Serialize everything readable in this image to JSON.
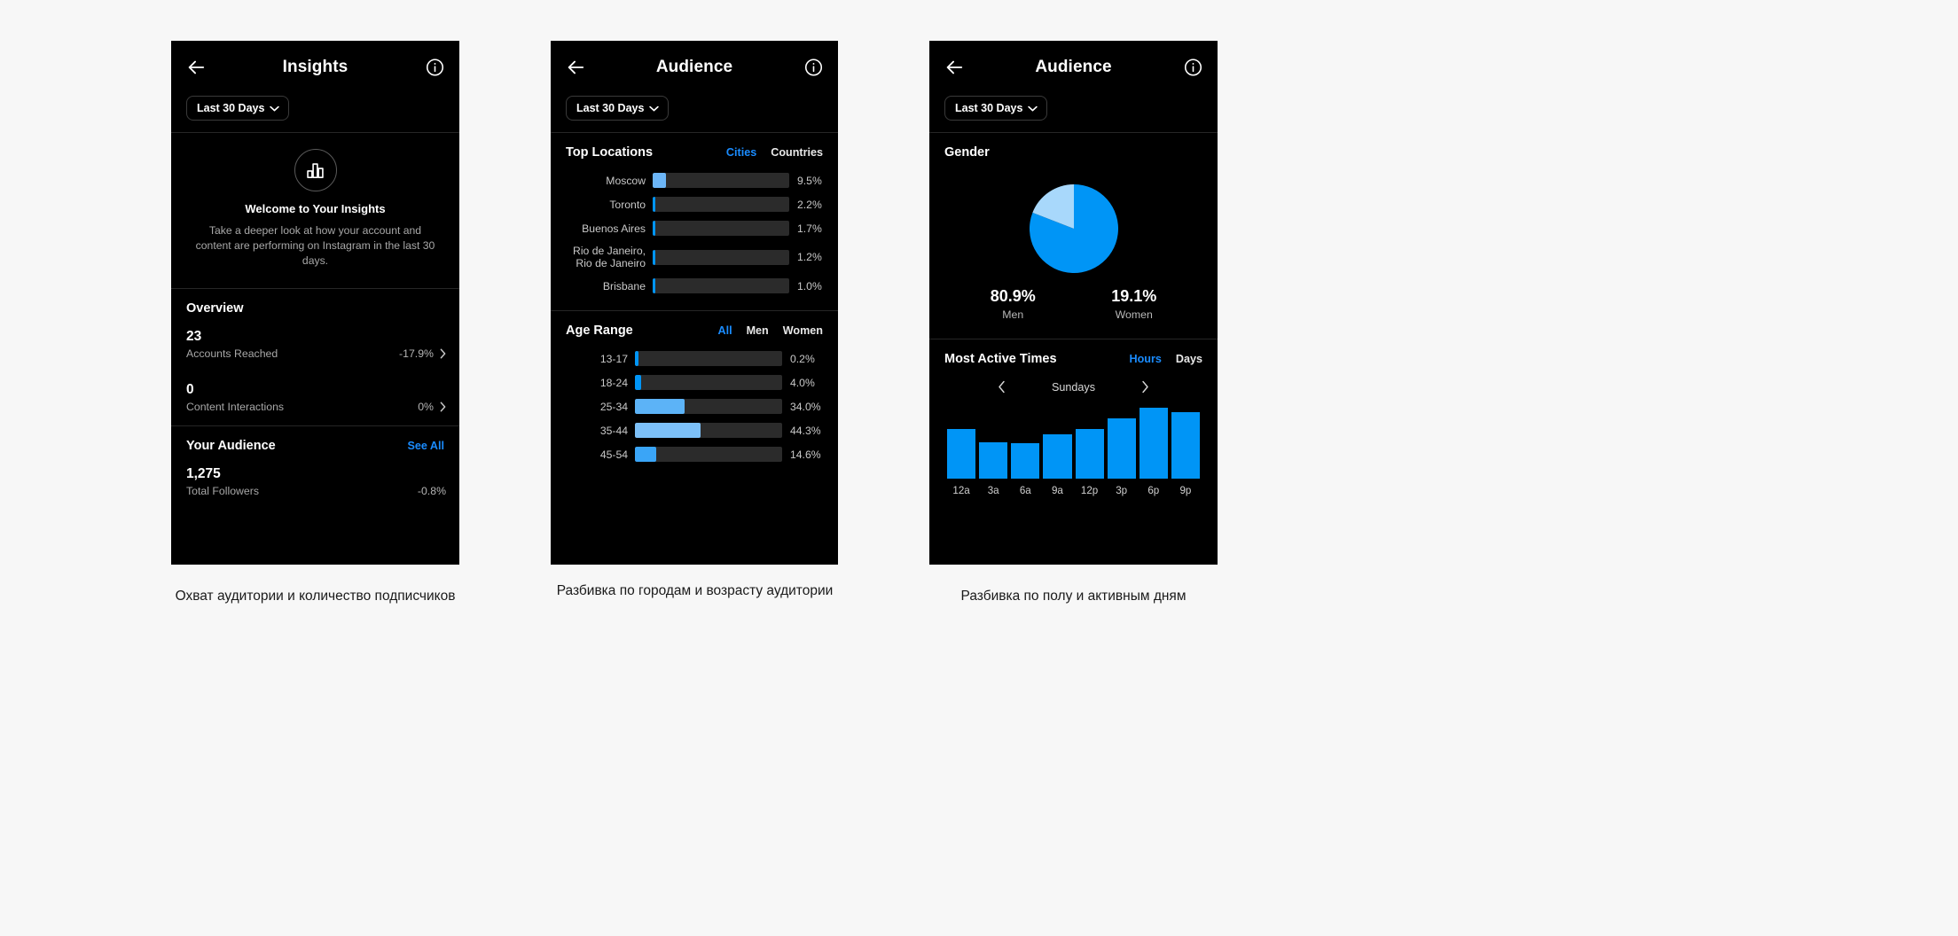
{
  "colors": {
    "accent": "#1a8cff",
    "bar_blue": "#0095f6",
    "bar_blue_light": "#6cb6f7",
    "track": "#2b2b2b",
    "phone_bg": "#000000",
    "page_bg": "#f7f7f7"
  },
  "phone1": {
    "header": {
      "title": "Insights",
      "back_icon": "arrow-left-icon",
      "info_icon": "info-circle-icon"
    },
    "range": {
      "label": "Last 30 Days",
      "chevron": "chevron-down-icon"
    },
    "welcome": {
      "icon": "bar-chart-icon",
      "title": "Welcome to Your Insights",
      "body": "Take a deeper look at how your account and content are performing on Instagram in the last 30 days."
    },
    "overview": {
      "title": "Overview",
      "rows": [
        {
          "value": "23",
          "label": "Accounts Reached",
          "delta": "-17.9%",
          "chevron": "chevron-right-icon"
        },
        {
          "value": "0",
          "label": "Content Interactions",
          "delta": "0%",
          "chevron": "chevron-right-icon"
        }
      ]
    },
    "audience": {
      "title": "Your Audience",
      "see_all": "See All",
      "rows": [
        {
          "value": "1,275",
          "label": "Total Followers",
          "delta": "-0.8%"
        }
      ]
    }
  },
  "phone2": {
    "header": {
      "title": "Audience",
      "back_icon": "arrow-left-icon",
      "info_icon": "info-circle-icon"
    },
    "range": {
      "label": "Last 30 Days",
      "chevron": "chevron-down-icon"
    },
    "top_locations": {
      "title": "Top Locations",
      "tabs": [
        {
          "label": "Cities",
          "active": true
        },
        {
          "label": "Countries",
          "active": false
        }
      ]
    },
    "age_range": {
      "title": "Age Range",
      "tabs": [
        {
          "label": "All",
          "active": true
        },
        {
          "label": "Men",
          "active": false
        },
        {
          "label": "Women",
          "active": false
        }
      ]
    }
  },
  "phone3": {
    "header": {
      "title": "Audience",
      "back_icon": "arrow-left-icon",
      "info_icon": "info-circle-icon"
    },
    "range": {
      "label": "Last 30 Days",
      "chevron": "chevron-down-icon"
    },
    "gender": {
      "title": "Gender",
      "legend": [
        {
          "value": "80.9%",
          "label": "Men"
        },
        {
          "value": "19.1%",
          "label": "Women"
        }
      ]
    },
    "active_times": {
      "title": "Most Active Times",
      "tabs": [
        {
          "label": "Hours",
          "active": true
        },
        {
          "label": "Days",
          "active": false
        }
      ],
      "day_label": "Sundays",
      "prev_icon": "chevron-left-icon",
      "next_icon": "chevron-right-icon"
    }
  },
  "captions": {
    "one": "Охват аудитории и количество подписчиков",
    "two": "Разбивка по городам и возрасту аудитории",
    "three": "Разбивка по полу и активным дням"
  },
  "chart_data": [
    {
      "type": "bar",
      "title": "Top Locations",
      "orientation": "horizontal",
      "categories": [
        "Moscow",
        "Toronto",
        "Buenos Aires",
        "Rio de Janeiro, Rio de Janeiro",
        "Brisbane"
      ],
      "values": [
        9.5,
        2.2,
        1.7,
        1.2,
        1.0
      ],
      "value_labels": [
        "9.5%",
        "2.2%",
        "1.7%",
        "1.2%",
        "1.0%"
      ],
      "bar_colors": [
        "#6cb6f7",
        "#0095f6",
        "#0095f6",
        "#0095f6",
        "#0095f6"
      ],
      "track_max": 100,
      "fill_fraction_of_track": [
        0.095,
        0.022,
        0.017,
        0.012,
        0.01
      ],
      "xlabel": "",
      "ylabel": "",
      "grid": false,
      "legend": false
    },
    {
      "type": "bar",
      "title": "Age Range",
      "orientation": "horizontal",
      "categories": [
        "13-17",
        "18-24",
        "25-34",
        "35-44",
        "45-54"
      ],
      "values": [
        0.2,
        4.0,
        34.0,
        44.3,
        14.6
      ],
      "value_labels": [
        "0.2%",
        "4.0%",
        "34.0%",
        "44.3%",
        "14.6%"
      ],
      "bar_colors": [
        "#0095f6",
        "#0095f6",
        "#5cb3f7",
        "#7cc0f8",
        "#3aa5f7"
      ],
      "track_max": 100,
      "fill_fraction_of_track": [
        0.002,
        0.04,
        0.34,
        0.443,
        0.146
      ],
      "xlabel": "",
      "ylabel": "",
      "grid": false,
      "legend": false
    },
    {
      "type": "pie",
      "title": "Gender",
      "labels": [
        "Men",
        "Women"
      ],
      "values": [
        80.9,
        19.1
      ],
      "value_labels": [
        "80.9%",
        "19.1%"
      ],
      "colors": [
        "#0095f6",
        "#a8d8fb"
      ],
      "legend": "below"
    },
    {
      "type": "bar",
      "title": "Most Active Times",
      "subtitle": "Sundays",
      "orientation": "vertical",
      "categories": [
        "12a",
        "3a",
        "6a",
        "9a",
        "12p",
        "3p",
        "6p",
        "9p"
      ],
      "values": [
        62,
        45,
        44,
        55,
        62,
        75,
        88,
        82
      ],
      "color": "#0095f6",
      "xlabel": "",
      "ylabel": "",
      "grid": false,
      "legend": false,
      "ylim": [
        0,
        100
      ]
    }
  ]
}
